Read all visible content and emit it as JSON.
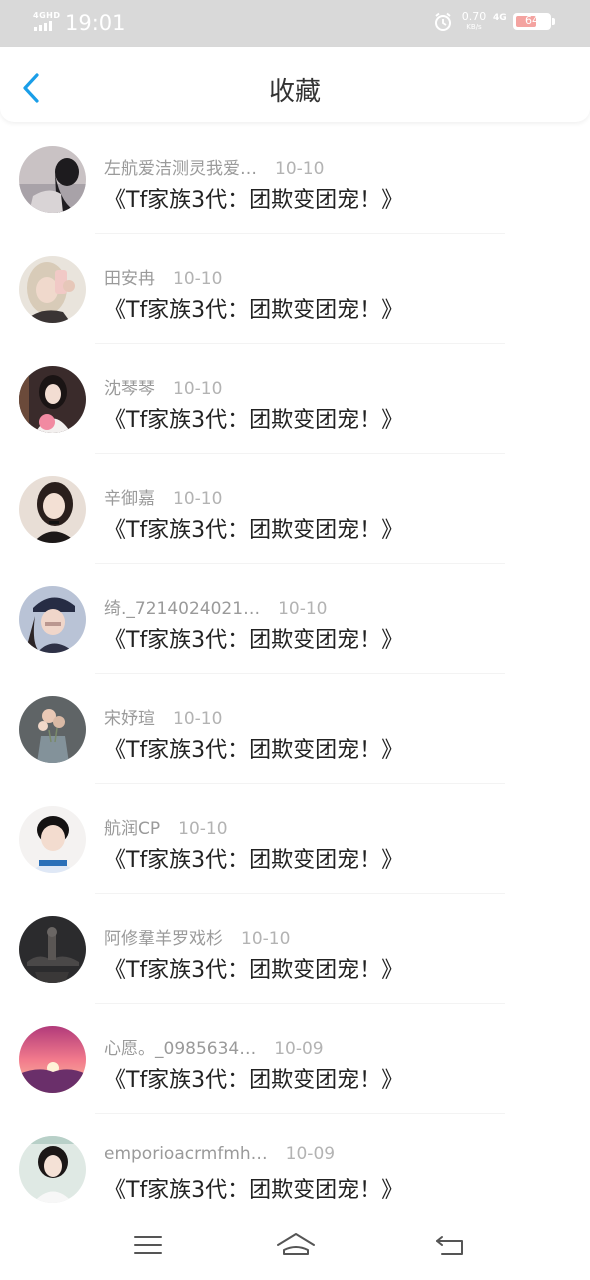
{
  "status_bar": {
    "network_label": "4GHD",
    "time": "19:01",
    "speed_value": "0.70",
    "speed_unit": "KB/s",
    "network_type": "4G",
    "battery": "64",
    "battery_level_percent": 64
  },
  "header": {
    "title": "收藏"
  },
  "favorites": [
    {
      "name": "左航爱洁测灵我爱…",
      "date": "10-10",
      "title": "《Tf家族3代：团欺变团宠！》"
    },
    {
      "name": "田安冉",
      "date": "10-10",
      "title": "《Tf家族3代：团欺变团宠！》"
    },
    {
      "name": "沈琴琴",
      "date": "10-10",
      "title": "《Tf家族3代：团欺变团宠！》"
    },
    {
      "name": "辛御嘉",
      "date": "10-10",
      "title": "《Tf家族3代：团欺变团宠！》"
    },
    {
      "name": "绮._7214024021…",
      "date": "10-10",
      "title": "《Tf家族3代：团欺变团宠！》"
    },
    {
      "name": "宋妤瑄",
      "date": "10-10",
      "title": "《Tf家族3代：团欺变团宠！》"
    },
    {
      "name": "航润CP",
      "date": "10-10",
      "title": "《Tf家族3代：团欺变团宠！》"
    },
    {
      "name": "阿修羣羊罗戏杉",
      "date": "10-10",
      "title": "《Tf家族3代：团欺变团宠！》"
    },
    {
      "name": "心愿。_0985634…",
      "date": "10-09",
      "title": "《Tf家族3代：团欺变团宠！》"
    },
    {
      "name": "emporioacrmfmh…",
      "date": "10-09",
      "title": "《Tf家族3代：团欺变团宠！》"
    }
  ],
  "colors": {
    "accent": "#1a9ee8",
    "status_bar_bg": "#d9d9d9",
    "text_primary": "#222222",
    "text_secondary": "#999999"
  },
  "system_nav": {
    "icons": [
      "menu-icon",
      "home-icon",
      "back-icon"
    ]
  }
}
